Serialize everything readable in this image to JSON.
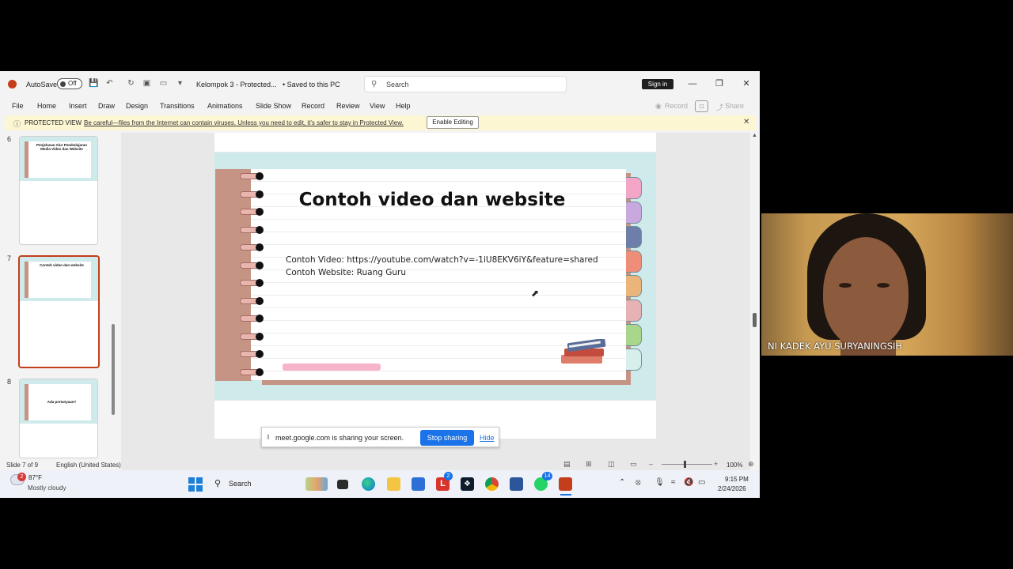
{
  "titlebar": {
    "autosave_label": "AutoSave",
    "autosave_state": "Off",
    "doc_title": "Kelompok 3  -  Protected...",
    "doc_saved": "• Saved to this PC",
    "search_placeholder": "Search",
    "signin": "Sign in"
  },
  "menu": {
    "tabs": [
      "File",
      "Home",
      "Insert",
      "Draw",
      "Design",
      "Transitions",
      "Animations",
      "Slide Show",
      "Record",
      "Review",
      "View",
      "Help"
    ],
    "record_right": "Record",
    "share_right": "Share"
  },
  "protected_view": {
    "title": "PROTECTED VIEW",
    "message": "Be careful—files from the Internet can contain viruses. Unless you need to edit, it's safer to stay in Protected View.",
    "button": "Enable Editing"
  },
  "thumbnails": [
    {
      "number": "6",
      "title": "Penjelasan Alur Pembelajaran Media Video dan Website",
      "selected": false
    },
    {
      "number": "7",
      "title": "Contoh video dan website",
      "selected": true
    },
    {
      "number": "8",
      "title": "Ada pertanyaan?",
      "selected": false
    }
  ],
  "slide": {
    "title": "Contoh video dan website",
    "line1": "Contoh Video: https://youtube.com/watch?v=-1iU8EKV6iY&feature=shared",
    "line2": "Contoh Website: Ruang Guru",
    "tab_colors": [
      "#f4a6c8",
      "#c9a8e0",
      "#6d7fa8",
      "#ef8e78",
      "#eab47a",
      "#e7b2b4",
      "#a8d68a",
      "#d6efec"
    ]
  },
  "share_banner": {
    "message": "meet.google.com is sharing your screen.",
    "stop": "Stop sharing",
    "hide": "Hide"
  },
  "statusbar": {
    "slide_info": "Slide 7 of 9",
    "language": "English (United States)",
    "zoom": "100%"
  },
  "taskbar": {
    "temperature": "87°F",
    "weather": "Mostly cloudy",
    "weather_badge": "2",
    "search": "Search",
    "badge_l": "2",
    "badge_whatsapp": "14",
    "time": "9:15 PM",
    "date": "2/24/2026"
  },
  "webcam": {
    "name": "NI KADEK AYU SURYANINGSIH"
  }
}
